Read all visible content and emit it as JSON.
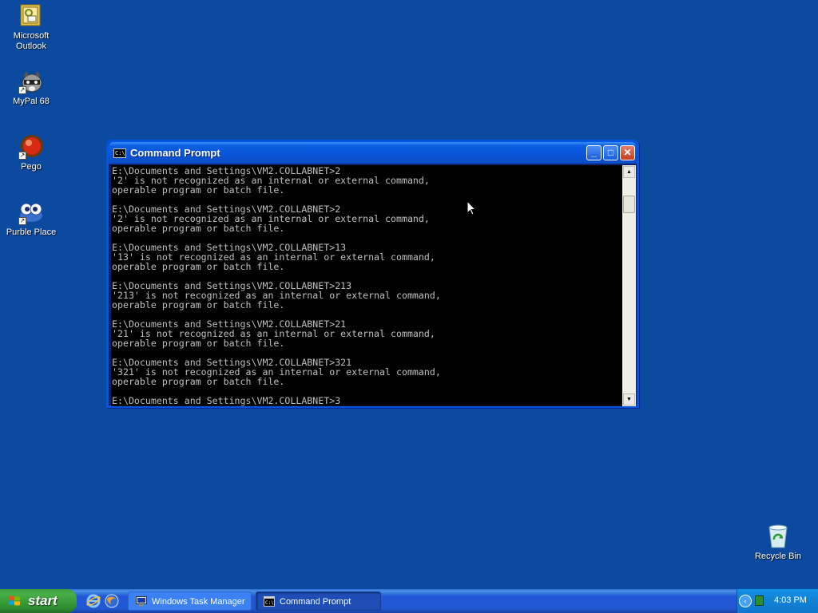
{
  "desktop": {
    "icons": [
      {
        "label": "Microsoft Outlook",
        "icon": "outlook-icon"
      },
      {
        "label": "MyPal 68",
        "icon": "raccoon-icon"
      },
      {
        "label": "Pego",
        "icon": "red-ball-icon"
      },
      {
        "label": "Purble Place",
        "icon": "purble-eyes-icon"
      },
      {
        "label": "Recycle Bin",
        "icon": "recycle-bin-icon"
      }
    ]
  },
  "window": {
    "title": "Command Prompt",
    "icon": "console-icon",
    "buttons": {
      "minimize": "_",
      "maximize": "□",
      "close": "✕"
    },
    "console_lines": "E:\\Documents and Settings\\VM2.COLLABNET>2\n'2' is not recognized as an internal or external command,\noperable program or batch file.\n\nE:\\Documents and Settings\\VM2.COLLABNET>2\n'2' is not recognized as an internal or external command,\noperable program or batch file.\n\nE:\\Documents and Settings\\VM2.COLLABNET>13\n'13' is not recognized as an internal or external command,\noperable program or batch file.\n\nE:\\Documents and Settings\\VM2.COLLABNET>213\n'213' is not recognized as an internal or external command,\noperable program or batch file.\n\nE:\\Documents and Settings\\VM2.COLLABNET>21\n'21' is not recognized as an internal or external command,\noperable program or batch file.\n\nE:\\Documents and Settings\\VM2.COLLABNET>321\n'321' is not recognized as an internal or external command,\noperable program or batch file.\n\nE:\\Documents and Settings\\VM2.COLLABNET>3",
    "scrollbar": {
      "up": "▲",
      "down": "▼"
    }
  },
  "taskbar": {
    "start_label": "start",
    "quick_launch": [
      "ie-icon",
      "firefox-icon"
    ],
    "tasks": [
      {
        "label": "Windows Task Manager",
        "icon": "task-manager-icon",
        "active": false
      },
      {
        "label": "Command Prompt",
        "icon": "console-icon",
        "active": true
      }
    ],
    "tray": {
      "chevron": "‹",
      "clock": "4:03 PM"
    }
  },
  "colors": {
    "desktop": "#0b4a9e",
    "titlebar": "#0a54d8",
    "taskbar": "#2258d4",
    "start": "#3c9c3c",
    "console_text": "#c0c0c0"
  }
}
